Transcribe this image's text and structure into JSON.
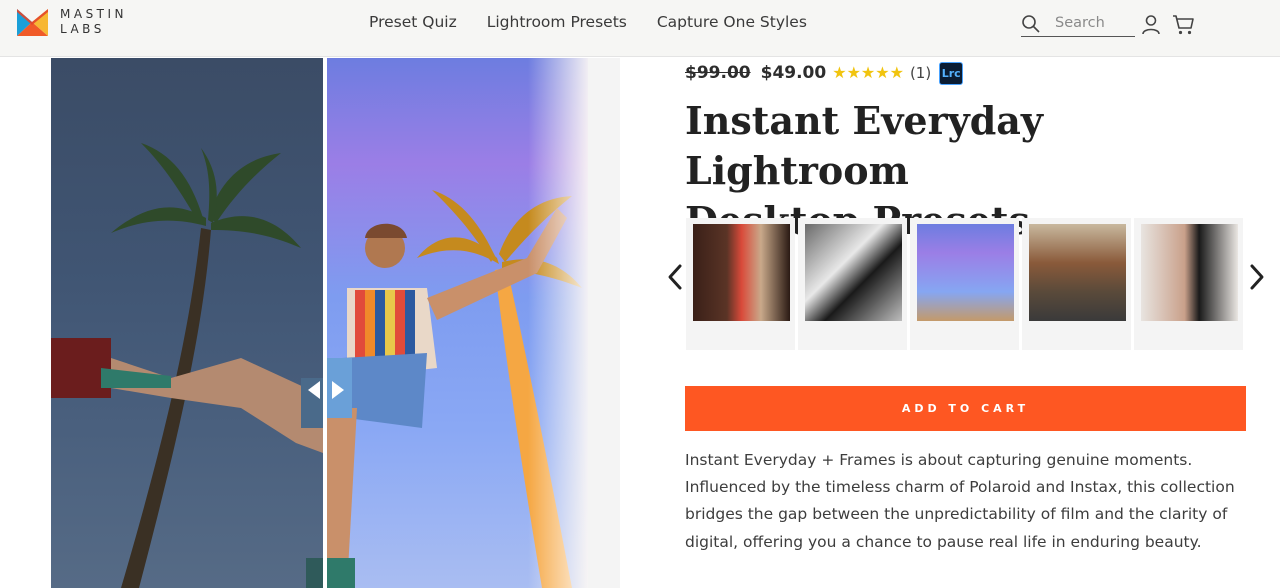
{
  "header": {
    "logo_name": "mastin-labs-logo",
    "logo_line1": "MASTIN",
    "logo_line2": "LABS",
    "nav": [
      {
        "label": "Preset Quiz"
      },
      {
        "label": "Lightroom Presets"
      },
      {
        "label": "Capture One Styles"
      }
    ],
    "search_placeholder": "Search",
    "icons": [
      "search-icon",
      "account-icon",
      "cart-icon"
    ]
  },
  "product": {
    "old_price": "$99.00",
    "new_price": "$49.00",
    "rating_stars": "★★★★★",
    "rating_value": 5,
    "review_count": "(1)",
    "badge": "Lrc",
    "title_line1": "Instant Everyday Lightroom",
    "title_line2": "Desktop Presets",
    "add_to_cart_label": "ADD TO CART",
    "description": "Instant Everyday + Frames is about capturing genuine moments. Influenced by the timeless charm of Polaroid and Instax, this collection bridges the gap between the unpredictability of film and the clarity of digital, offering you a chance to pause real life in enduring beauty."
  },
  "gallery": {
    "compare_handle_icon": "compare-arrows-icon",
    "thumbnail_count": 5,
    "nav_icons": [
      "chevron-left-icon",
      "chevron-right-icon"
    ]
  },
  "colors": {
    "accent": "#fe5722",
    "header_bg": "#f6f6f4",
    "star": "#f1c40f",
    "logo_orange": "#f05a28",
    "logo_blue": "#1a9fd8",
    "logo_yellow": "#f7b733"
  }
}
